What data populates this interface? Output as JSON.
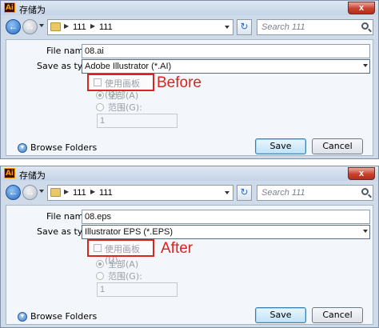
{
  "dialogs": [
    {
      "title": "存储为",
      "app_icon": "Ai",
      "close_glyph": "x",
      "address": {
        "crumbs": [
          "111",
          "111"
        ]
      },
      "search_placeholder": "Search 111",
      "file_name_label": "File name:",
      "file_name_value": "08.ai",
      "save_as_type_label": "Save as type:",
      "save_as_type_value": "Adobe Illustrator (*.AI)",
      "artboard_checkbox_label": "使用画板(U)",
      "artboard_checked": false,
      "annotation": "Before",
      "radio_all_label": "全部(A)",
      "radio_range_label": "范围(G):",
      "range_value": "1",
      "browse_folders_label": "Browse Folders",
      "save_label": "Save",
      "cancel_label": "Cancel"
    },
    {
      "title": "存储为",
      "app_icon": "Ai",
      "close_glyph": "x",
      "address": {
        "crumbs": [
          "111",
          "111"
        ]
      },
      "search_placeholder": "Search 111",
      "file_name_label": "File name:",
      "file_name_value": "08.eps",
      "save_as_type_label": "Save as type:",
      "save_as_type_value": "Illustrator EPS (*.EPS)",
      "artboard_checkbox_label": "使用画板(U)",
      "artboard_checked": false,
      "annotation": "After",
      "radio_all_label": "全部(A)",
      "radio_range_label": "范围(G):",
      "range_value": "1",
      "browse_folders_label": "Browse Folders",
      "save_label": "Save",
      "cancel_label": "Cancel"
    }
  ],
  "colors": {
    "annotation_red": "#d7261f",
    "window_frame": "#cfdbe9",
    "accent_blue": "#2a6bc4"
  },
  "icons": [
    "ai-app-icon",
    "close-icon",
    "back-arrow-icon",
    "forward-arrow-icon",
    "folder-icon",
    "refresh-icon",
    "search-icon",
    "chevron-down-icon",
    "browse-folders-icon"
  ]
}
